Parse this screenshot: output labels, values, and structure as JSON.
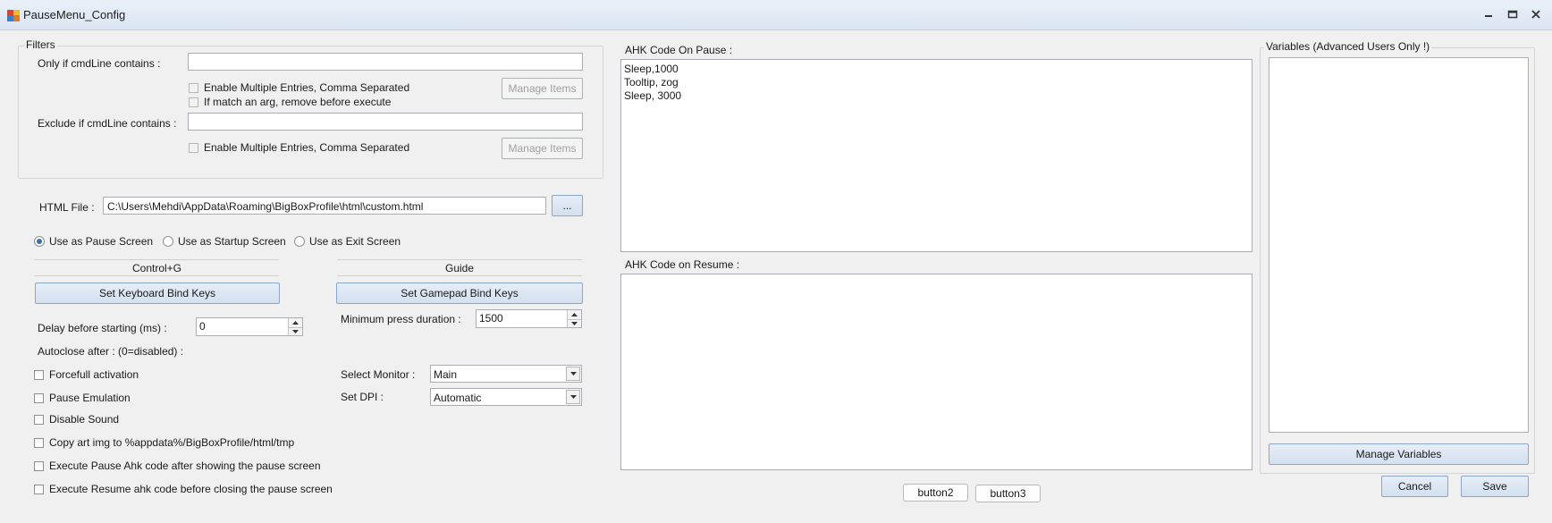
{
  "window": {
    "title": "PauseMenu_Config",
    "buttons": [
      "minimize-icon",
      "restore-icon",
      "close-icon"
    ]
  },
  "filters": {
    "group_label": "Filters",
    "include_label": "Only if cmdLine contains :",
    "include_value": "",
    "include_multi": "Enable Multiple Entries, Comma Separated",
    "include_remove_arg": "If match an arg, remove before execute",
    "include_manage": "Manage Items",
    "exclude_label": "Exclude if cmdLine contains :",
    "exclude_value": "",
    "exclude_multi": "Enable Multiple Entries, Comma Separated",
    "exclude_manage": "Manage Items"
  },
  "html_file": {
    "label": "HTML File :",
    "value": "C:\\Users\\Mehdi\\AppData\\Roaming\\BigBoxProfile\\html\\custom.html",
    "browse": "..."
  },
  "screen_mode": {
    "options": [
      "Use as Pause Screen",
      "Use as Startup Screen",
      "Use as Exit Screen"
    ],
    "selected": "Use as Pause Screen"
  },
  "keyboard": {
    "binding": "Control+G",
    "set_button": "Set Keyboard Bind Keys"
  },
  "gamepad": {
    "binding": "Guide",
    "set_button": "Set Gamepad Bind Keys"
  },
  "delay": {
    "label": "Delay before starting (ms) :",
    "value": "0"
  },
  "min_press": {
    "label": "Minimum press duration :",
    "value": "1500"
  },
  "autoclose": {
    "label": "Autoclose after : (0=disabled) :"
  },
  "options": [
    "Forcefull activation",
    "Pause Emulation",
    "Disable Sound",
    "Copy art img to %appdata%/BigBoxProfile/html/tmp",
    "Execute Pause Ahk code after showing the pause screen",
    "Execute Resume ahk code before closing the pause screen"
  ],
  "monitor": {
    "label": "Select Monitor :",
    "value": "Main"
  },
  "dpi": {
    "label": "Set DPI :",
    "value": "Automatic"
  },
  "ahk_pause": {
    "label": "AHK Code On Pause :",
    "lines": [
      "Sleep,1000",
      "Tooltip, zog",
      "Sleep, 3000"
    ]
  },
  "ahk_resume": {
    "label": "AHK Code on Resume :",
    "lines": []
  },
  "variables": {
    "label": "Variables (Advanced Users Only !)",
    "manage": "Manage Variables"
  },
  "footer": {
    "button2": "button2",
    "button3": "button3",
    "cancel": "Cancel",
    "save": "Save"
  }
}
